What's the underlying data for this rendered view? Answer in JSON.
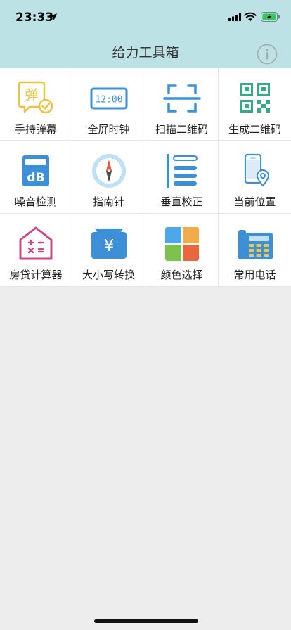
{
  "status_bar": {
    "time": "23:33",
    "icons": [
      "location-arrow-icon",
      "signal-icon",
      "wifi-icon",
      "battery-charging-icon"
    ]
  },
  "nav": {
    "title": "给力工具箱",
    "info_icon": "info-icon"
  },
  "colors": {
    "header_bg": "#bde2e6",
    "page_bg": "#ededed",
    "accent_blue": "#3d8fd6"
  },
  "tools": [
    {
      "label": "手持弹幕",
      "icon": "barrage-icon"
    },
    {
      "label": "全屏时钟",
      "icon": "clock-icon"
    },
    {
      "label": "扫描二维码",
      "icon": "scan-icon"
    },
    {
      "label": "生成二维码",
      "icon": "qr-code-icon"
    },
    {
      "label": "噪音检测",
      "icon": "decibel-meter-icon"
    },
    {
      "label": "指南针",
      "icon": "compass-icon"
    },
    {
      "label": "垂直校正",
      "icon": "level-icon"
    },
    {
      "label": "当前位置",
      "icon": "phone-location-icon"
    },
    {
      "label": "房贷计算器",
      "icon": "mortgage-calculator-icon"
    },
    {
      "label": "大小写转换",
      "icon": "currency-convert-icon"
    },
    {
      "label": "颜色选择",
      "icon": "color-picker-icon"
    },
    {
      "label": "常用电话",
      "icon": "telephone-icon"
    }
  ],
  "barrage_icon_text": "弹",
  "clock_icon_text": "12:00",
  "decibel_icon_text": "dB",
  "currency_icon_text": "¥"
}
